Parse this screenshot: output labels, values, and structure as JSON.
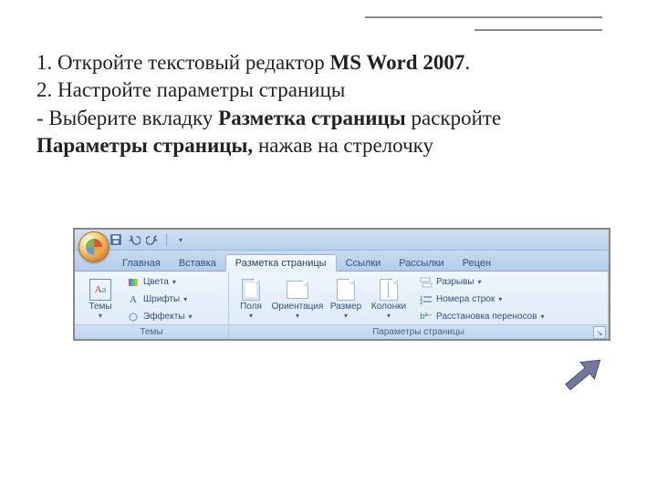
{
  "instructions": {
    "line1_pre": "1. Откройте текстовый редактор ",
    "line1_bold": "MS Word 2007",
    "line1_post": ".",
    "line2": "2. Настройте параметры страницы",
    "line3_pre": "- Выберите вкладку ",
    "line3_b1": "Разметка страницы",
    "line3_mid": " раскройте ",
    "line3_b2": "Параметры страницы,",
    "line3_post": " нажав на стрелочку"
  },
  "ribbon": {
    "tabs": {
      "home": "Главная",
      "insert": "Вставка",
      "layout": "Разметка страницы",
      "references": "Ссылки",
      "mailings": "Рассылки",
      "review": "Рецен"
    },
    "groups": {
      "themes": {
        "title": "Темы",
        "themes_btn": "Темы",
        "colors": "Цвета",
        "fonts": "Шрифты",
        "effects": "Эффекты"
      },
      "page_setup": {
        "title": "Параметры страницы",
        "margins": "Поля",
        "orientation": "Ориентация",
        "size": "Размер",
        "columns": "Колонки",
        "breaks": "Разрывы",
        "line_numbers": "Номера строк",
        "hyphenation": "Расстановка переносов"
      }
    }
  }
}
